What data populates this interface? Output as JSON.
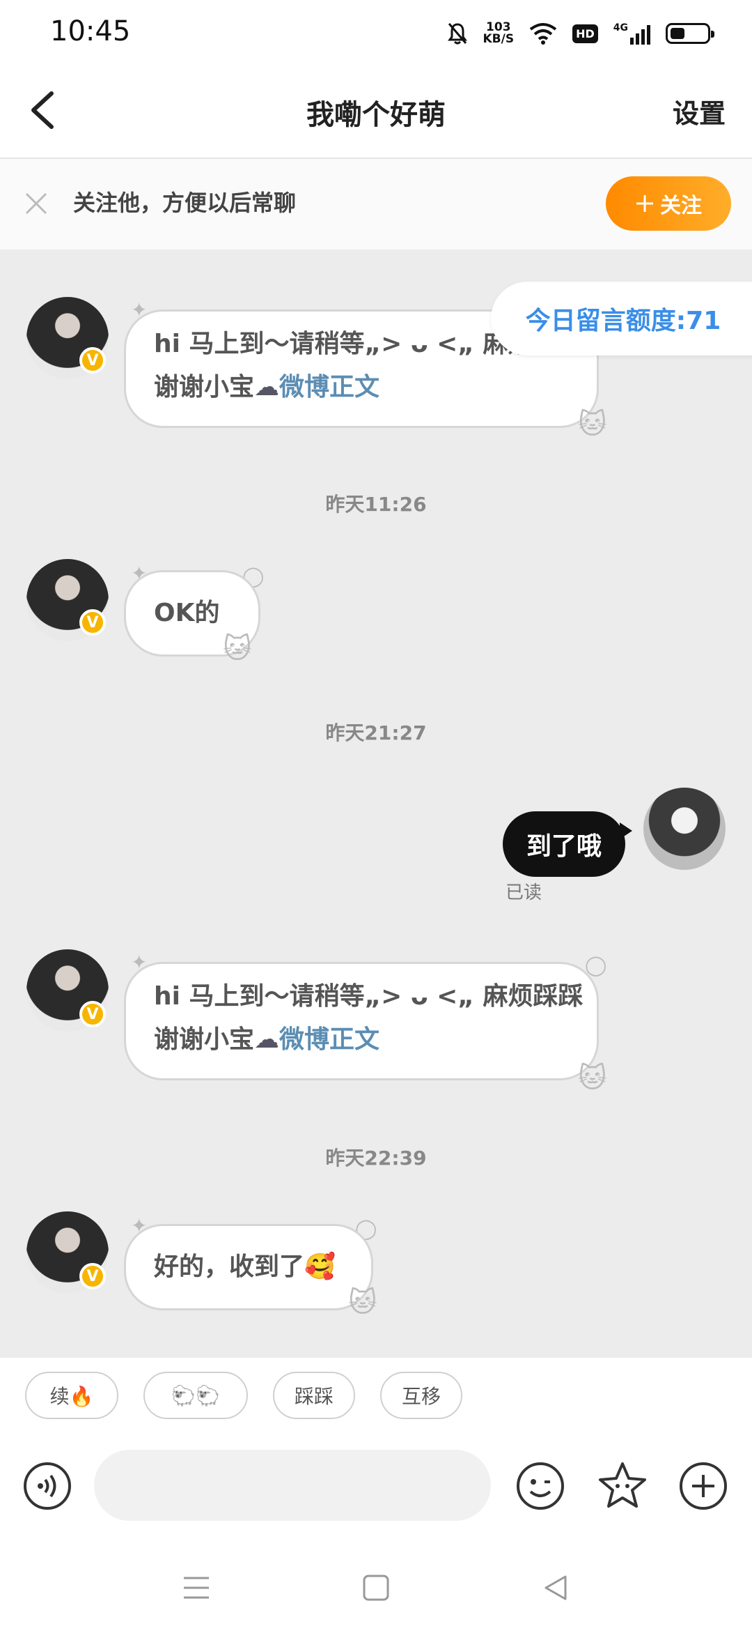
{
  "status_bar": {
    "time": "10:45",
    "net_speed_value": "103",
    "net_speed_unit": "KB/S",
    "hd_label": "HD",
    "network_type": "4G"
  },
  "header": {
    "title": "我嘞个好萌",
    "settings_label": "设置"
  },
  "follow_bar": {
    "prompt": "关注他，方便以后常聊",
    "follow_button": "关注"
  },
  "quota_label": "今日留言额度:71",
  "messages": [
    {
      "line1": "hi 马上到～请稍等„> ᴗ <„ 麻烦",
      "line2": "谢谢小宝",
      "link": "微博正文"
    },
    {
      "time": "昨天11:26",
      "text": "OK的"
    },
    {
      "time": "昨天21:27",
      "text": "到了哦",
      "status": "已读"
    },
    {
      "line1": "hi 马上到～请稍等„> ᴗ <„ 麻烦踩踩",
      "line2": "谢谢小宝",
      "link": "微博正文"
    },
    {
      "time": "昨天22:39",
      "text": "好的，收到了"
    }
  ],
  "quick_replies": [
    "续🔥",
    "🐑🐑",
    "踩踩",
    "互移"
  ],
  "colors": {
    "accent": "#ff8a00",
    "link": "#5b8db3",
    "quota": "#3a8ee8",
    "chat_bg": "#ececec"
  }
}
